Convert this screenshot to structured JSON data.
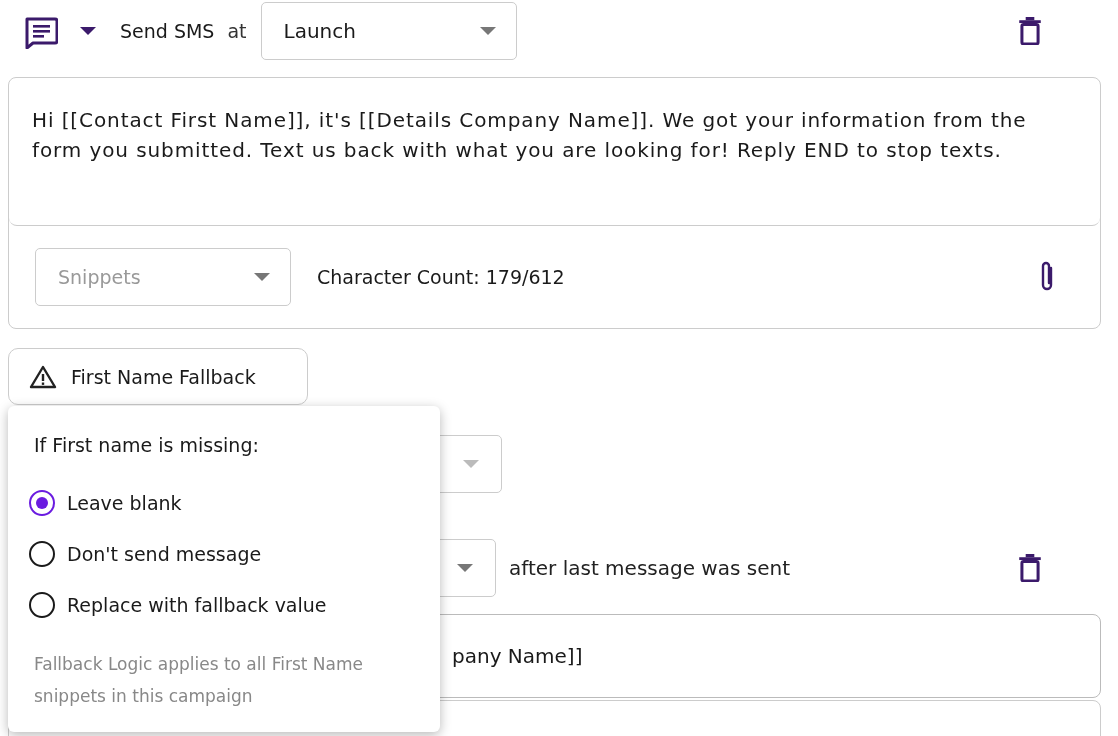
{
  "step": {
    "channel": "Send SMS",
    "at_label": "at",
    "trigger": {
      "value": "Launch"
    },
    "message": "Hi [[Contact First Name]], it's [[Details Company Name]]. We got your information from the form you submitted. Text us back with what you are looking for! Reply END to stop texts.",
    "snippets": {
      "placeholder": "Snippets"
    },
    "character_count": "Character Count: 179/612"
  },
  "fallback_button": "First Name Fallback",
  "step2": {
    "delay_suffix": "after last message was sent",
    "message_visible": "pany Name]]"
  },
  "fallback_popover": {
    "title": "If First name is missing:",
    "options": [
      {
        "label": "Leave blank",
        "selected": true
      },
      {
        "label": "Don't send message",
        "selected": false
      },
      {
        "label": "Replace with fallback value",
        "selected": false
      }
    ],
    "note": "Fallback Logic applies to all First Name snippets in this campaign"
  }
}
